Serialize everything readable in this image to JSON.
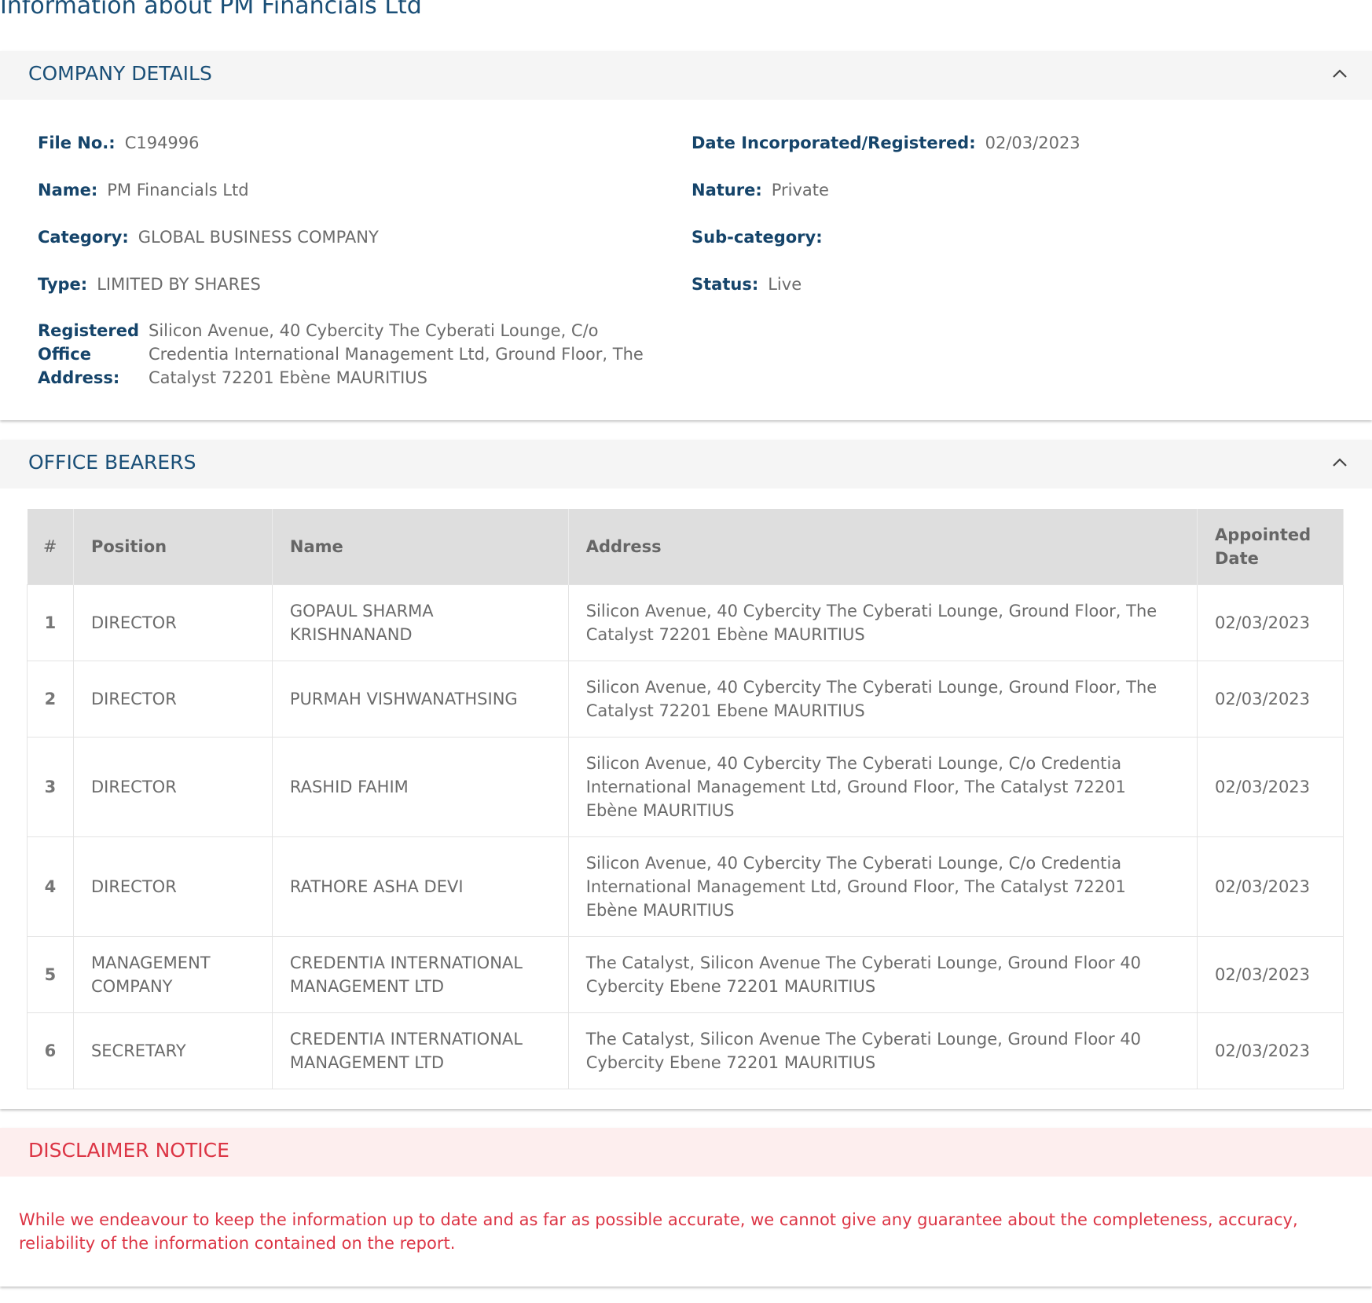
{
  "page": {
    "title": "Information about PM Financials Ltd"
  },
  "company_details": {
    "heading": "COMPANY DETAILS",
    "fields": {
      "file_no": {
        "label": "File No.:",
        "value": "C194996"
      },
      "date_incorporated": {
        "label": "Date Incorporated/Registered:",
        "value": "02/03/2023"
      },
      "name": {
        "label": "Name:",
        "value": "PM Financials Ltd"
      },
      "nature": {
        "label": "Nature:",
        "value": "Private"
      },
      "category": {
        "label": "Category:",
        "value": "GLOBAL BUSINESS COMPANY"
      },
      "sub_category": {
        "label": "Sub-category:",
        "value": ""
      },
      "type": {
        "label": "Type:",
        "value": "LIMITED BY SHARES"
      },
      "status": {
        "label": "Status:",
        "value": "Live"
      },
      "registered_office": {
        "label": "Registered Office Address:",
        "value": "Silicon Avenue, 40 Cybercity The Cyberati Lounge, C/o Credentia International Management Ltd, Ground Floor, The Catalyst 72201 Ebène MAURITIUS"
      }
    }
  },
  "office_bearers": {
    "heading": "OFFICE BEARERS",
    "columns": [
      "#",
      "Position",
      "Name",
      "Address",
      "Appointed Date"
    ],
    "rows": [
      {
        "num": "1",
        "position": "DIRECTOR",
        "name": "GOPAUL SHARMA KRISHNANAND",
        "address": "Silicon Avenue, 40 Cybercity The Cyberati Lounge, Ground Floor, The Catalyst 72201 Ebène MAURITIUS",
        "date": "02/03/2023"
      },
      {
        "num": "2",
        "position": "DIRECTOR",
        "name": "PURMAH VISHWANATHSING",
        "address": "Silicon Avenue, 40 Cybercity The Cyberati Lounge, Ground Floor, The Catalyst 72201 Ebene MAURITIUS",
        "date": "02/03/2023"
      },
      {
        "num": "3",
        "position": "DIRECTOR",
        "name": "RASHID FAHIM",
        "address": "Silicon Avenue, 40 Cybercity The Cyberati Lounge, C/o Credentia International Management Ltd, Ground Floor, The Catalyst 72201 Ebène MAURITIUS",
        "date": "02/03/2023"
      },
      {
        "num": "4",
        "position": "DIRECTOR",
        "name": "RATHORE ASHA DEVI",
        "address": "Silicon Avenue, 40 Cybercity The Cyberati Lounge, C/o Credentia International Management Ltd, Ground Floor, The Catalyst 72201 Ebène MAURITIUS",
        "date": "02/03/2023"
      },
      {
        "num": "5",
        "position": "MANAGEMENT COMPANY",
        "name": "CREDENTIA INTERNATIONAL MANAGEMENT LTD",
        "address": "The Catalyst, Silicon Avenue The Cyberati Lounge, Ground Floor 40 Cybercity Ebene 72201 MAURITIUS",
        "date": "02/03/2023"
      },
      {
        "num": "6",
        "position": "SECRETARY",
        "name": "CREDENTIA INTERNATIONAL MANAGEMENT LTD",
        "address": "The Catalyst, Silicon Avenue The Cyberati Lounge, Ground Floor 40 Cybercity Ebene 72201 MAURITIUS",
        "date": "02/03/2023"
      }
    ]
  },
  "disclaimer": {
    "heading": "DISCLAIMER NOTICE",
    "text": "While we endeavour to keep the information up to date and as far as possible accurate, we cannot give any guarantee about the completeness, accuracy, reliability of the information contained on the report."
  },
  "icons": {
    "collapse": "chevron-up-icon"
  },
  "colors": {
    "heading": "#1a4f77",
    "label": "#15446a",
    "danger": "#dc3545"
  }
}
